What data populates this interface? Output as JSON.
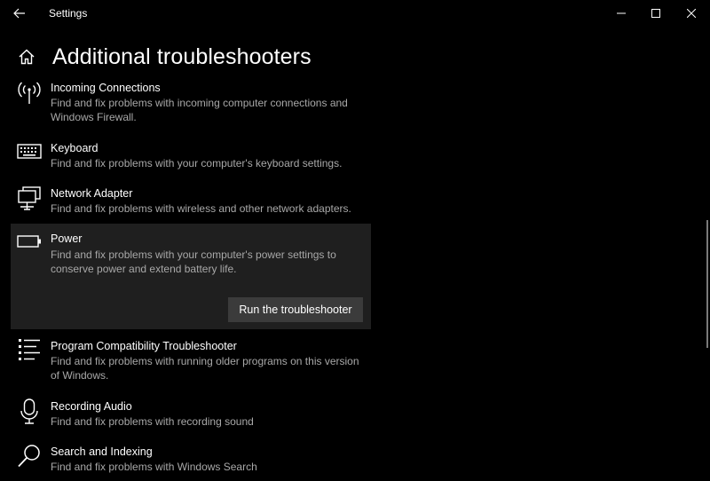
{
  "window": {
    "title": "Settings",
    "back_icon": "arrow-left-icon",
    "controls": [
      "minimize-icon",
      "maximize-icon",
      "close-icon"
    ]
  },
  "header": {
    "home_icon": "home-icon",
    "title": "Additional troubleshooters"
  },
  "troubleshooters": [
    {
      "name": "Incoming Connections",
      "description": "Find and fix problems with incoming computer connections and Windows Firewall.",
      "icon": "antenna-icon"
    },
    {
      "name": "Keyboard",
      "description": "Find and fix problems with your computer's keyboard settings.",
      "icon": "keyboard-icon"
    },
    {
      "name": "Network Adapter",
      "description": "Find and fix problems with wireless and other network adapters.",
      "icon": "network-adapter-icon"
    },
    {
      "name": "Power",
      "description": "Find and fix problems with your computer's power settings to conserve power and extend battery life.",
      "icon": "battery-icon",
      "selected": true
    },
    {
      "name": "Program Compatibility Troubleshooter",
      "description": "Find and fix problems with running older programs on this version of Windows.",
      "icon": "list-icon"
    },
    {
      "name": "Recording Audio",
      "description": "Find and fix problems with recording sound",
      "icon": "microphone-icon"
    },
    {
      "name": "Search and Indexing",
      "description": "Find and fix problems with Windows Search",
      "icon": "search-icon"
    }
  ],
  "run_button_label": "Run the troubleshooter",
  "colors": {
    "background": "#000000",
    "selected_background": "#1f1f1f",
    "button_background": "#3b3b3b",
    "secondary_text": "#a8a8a8"
  }
}
